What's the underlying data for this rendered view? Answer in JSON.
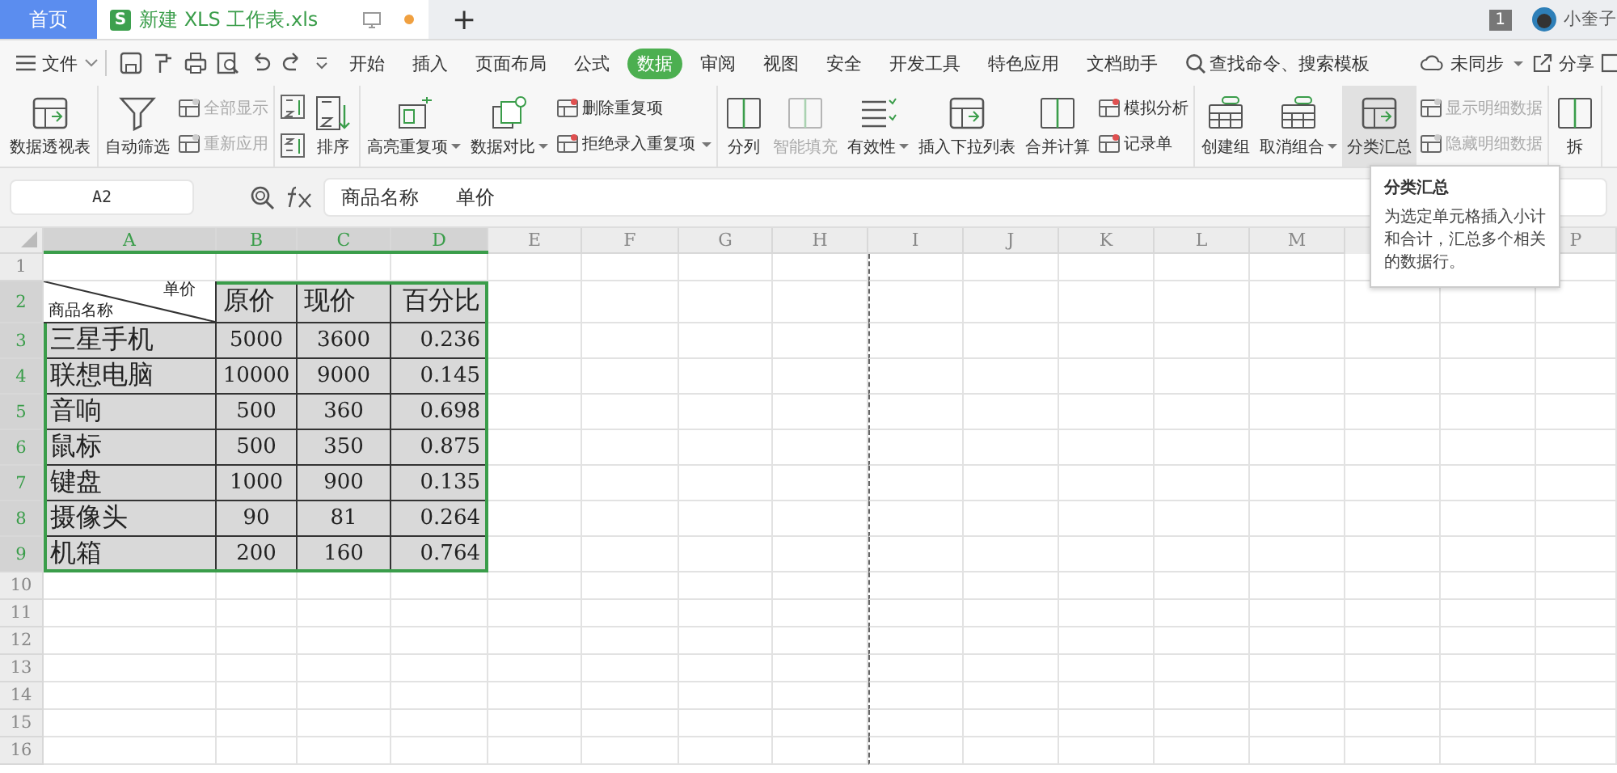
{
  "tabs": [
    {
      "kind": "home",
      "label": "首页",
      "selected": false
    },
    {
      "kind": "doc",
      "badge": "S",
      "label": "新建 XLS 工作表.xls",
      "selected": true,
      "modified": true
    }
  ],
  "new_tab": "+",
  "window_count": "1",
  "user": "小奎子",
  "menu": {
    "file": "文件",
    "tabs": [
      {
        "label": "开始",
        "selected": false
      },
      {
        "label": "插入",
        "selected": false
      },
      {
        "label": "页面布局",
        "selected": false
      },
      {
        "label": "公式",
        "selected": false
      },
      {
        "label": "数据",
        "selected": true
      },
      {
        "label": "审阅",
        "selected": false
      },
      {
        "label": "视图",
        "selected": false
      },
      {
        "label": "安全",
        "selected": false
      },
      {
        "label": "开发工具",
        "selected": false
      },
      {
        "label": "特色应用",
        "selected": false
      },
      {
        "label": "文档助手",
        "selected": false
      }
    ],
    "search": "查找命令、搜索模板",
    "sync": "未同步",
    "share": "分享"
  },
  "ribbon": [
    [
      {
        "kind": "large",
        "label": "数据透视表",
        "disabled": false,
        "dropdown": false,
        "highlighted": false
      }
    ],
    [
      {
        "kind": "large",
        "label": "自动筛选",
        "disabled": false,
        "dropdown": false,
        "highlighted": false
      },
      {
        "kind": "stack",
        "items": [
          {
            "label": "全部显示",
            "disabled": true,
            "dropdown": false
          },
          {
            "label": "重新应用",
            "disabled": true,
            "dropdown": false
          }
        ]
      }
    ],
    [
      {
        "kind": "icons"
      },
      {
        "kind": "large",
        "label": "排序",
        "disabled": false,
        "dropdown": false,
        "highlighted": false
      }
    ],
    [
      {
        "kind": "large",
        "label": "高亮重复项",
        "disabled": false,
        "dropdown": true,
        "highlighted": false
      },
      {
        "kind": "large",
        "label": "数据对比",
        "disabled": false,
        "dropdown": true,
        "highlighted": false
      },
      {
        "kind": "stack",
        "items": [
          {
            "label": "删除重复项",
            "disabled": false,
            "dropdown": false
          },
          {
            "label": "拒绝录入重复项",
            "disabled": false,
            "dropdown": true
          }
        ]
      }
    ],
    [
      {
        "kind": "large",
        "label": "分列",
        "disabled": false,
        "dropdown": false,
        "highlighted": false
      },
      {
        "kind": "large",
        "label": "智能填充",
        "disabled": true,
        "dropdown": false,
        "highlighted": false
      },
      {
        "kind": "large",
        "label": "有效性",
        "disabled": false,
        "dropdown": true,
        "highlighted": false
      },
      {
        "kind": "large",
        "label": "插入下拉列表",
        "disabled": false,
        "dropdown": false,
        "highlighted": false
      },
      {
        "kind": "large",
        "label": "合并计算",
        "disabled": false,
        "dropdown": false,
        "highlighted": false
      },
      {
        "kind": "stack",
        "items": [
          {
            "label": "模拟分析",
            "disabled": false,
            "dropdown": false
          },
          {
            "label": "记录单",
            "disabled": false,
            "dropdown": false
          }
        ]
      }
    ],
    [
      {
        "kind": "large",
        "label": "创建组",
        "disabled": false,
        "dropdown": false,
        "highlighted": false
      },
      {
        "kind": "large",
        "label": "取消组合",
        "disabled": false,
        "dropdown": true,
        "highlighted": false
      },
      {
        "kind": "large",
        "label": "分类汇总",
        "disabled": false,
        "dropdown": false,
        "highlighted": true
      },
      {
        "kind": "stack",
        "items": [
          {
            "label": "显示明细数据",
            "disabled": true,
            "dropdown": false
          },
          {
            "label": "隐藏明细数据",
            "disabled": true,
            "dropdown": false
          }
        ]
      }
    ],
    [
      {
        "kind": "large",
        "label": "拆",
        "disabled": false,
        "dropdown": false,
        "highlighted": false
      }
    ]
  ],
  "formula_bar": {
    "cell": "A2",
    "formula": "商品名称      单价"
  },
  "sheet": {
    "columns": [
      {
        "label": "A",
        "selected": true
      },
      {
        "label": "B",
        "selected": true
      },
      {
        "label": "C",
        "selected": true
      },
      {
        "label": "D",
        "selected": true
      },
      {
        "label": "E",
        "selected": false
      },
      {
        "label": "F",
        "selected": false
      },
      {
        "label": "G",
        "selected": false
      },
      {
        "label": "H",
        "selected": false
      },
      {
        "label": "I",
        "selected": false
      },
      {
        "label": "J",
        "selected": false
      },
      {
        "label": "K",
        "selected": false
      },
      {
        "label": "L",
        "selected": false
      },
      {
        "label": "M",
        "selected": false
      },
      {
        "label": "P",
        "selected": false
      }
    ],
    "rows": [
      {
        "label": "1",
        "selected": false
      },
      {
        "label": "2",
        "selected": true,
        "corner": {
          "top": "单价",
          "bottom": "商品名称"
        },
        "cells": [
          "原价",
          "现价",
          "百分比"
        ]
      },
      {
        "label": "3",
        "selected": true,
        "cells": [
          "三星手机",
          "5000",
          "3600",
          "0.236"
        ]
      },
      {
        "label": "4",
        "selected": true,
        "cells": [
          "联想电脑",
          "10000",
          "9000",
          "0.145"
        ]
      },
      {
        "label": "5",
        "selected": true,
        "cells": [
          "音响",
          "500",
          "360",
          "0.698"
        ]
      },
      {
        "label": "6",
        "selected": true,
        "cells": [
          "鼠标",
          "500",
          "350",
          "0.875"
        ]
      },
      {
        "label": "7",
        "selected": true,
        "cells": [
          "键盘",
          "1000",
          "900",
          "0.135"
        ]
      },
      {
        "label": "8",
        "selected": true,
        "cells": [
          "摄像头",
          "90",
          "81",
          "0.264"
        ]
      },
      {
        "label": "9",
        "selected": true,
        "cells": [
          "机箱",
          "200",
          "160",
          "0.764"
        ]
      },
      {
        "label": "10",
        "selected": false
      },
      {
        "label": "11",
        "selected": false
      },
      {
        "label": "12",
        "selected": false
      },
      {
        "label": "13",
        "selected": false
      },
      {
        "label": "14",
        "selected": false
      },
      {
        "label": "15",
        "selected": false
      },
      {
        "label": "16",
        "selected": false
      }
    ]
  },
  "tooltip": {
    "title": "分类汇总",
    "text": "为选定单元格插入小计和合计，汇总多个相关的数据行。"
  }
}
